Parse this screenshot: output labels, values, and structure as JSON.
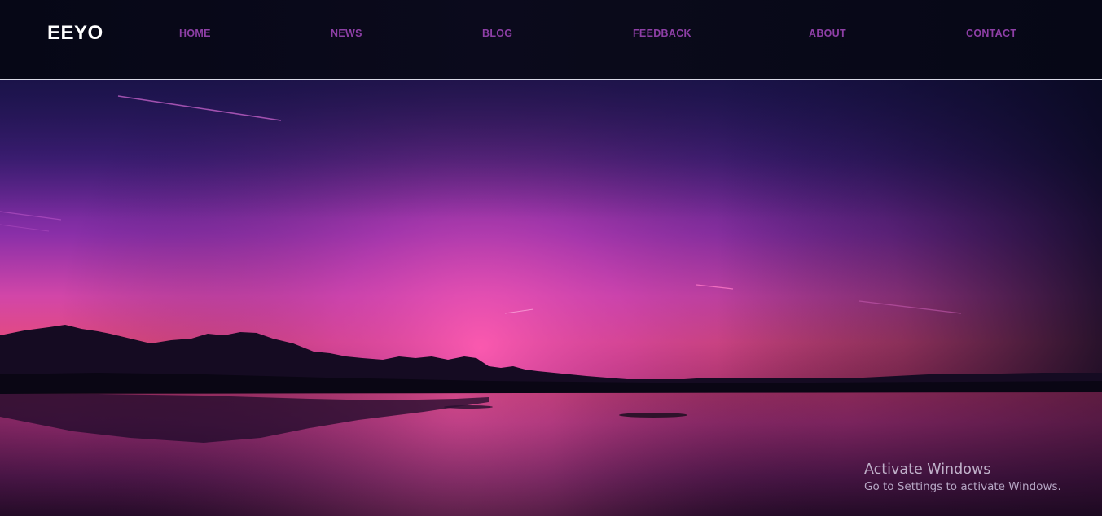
{
  "brand": {
    "logo": "EEYO"
  },
  "nav": {
    "items": [
      {
        "label": "HOME"
      },
      {
        "label": "NEWS"
      },
      {
        "label": "BLOG"
      },
      {
        "label": "FEEDBACK"
      },
      {
        "label": "ABOUT"
      },
      {
        "label": "CONTACT"
      }
    ]
  },
  "hero": {
    "image": "sunset-lake-mountains"
  },
  "watermark": {
    "title": "Activate Windows",
    "subtitle": "Go to Settings to activate Windows."
  },
  "colors": {
    "nav_bg": "#070818",
    "nav_link": "#8e3fa6",
    "logo": "#ffffff",
    "divider": "#d9d9e6",
    "sky_top": "#2a1a64",
    "sky_glow": "#f45bb3"
  }
}
